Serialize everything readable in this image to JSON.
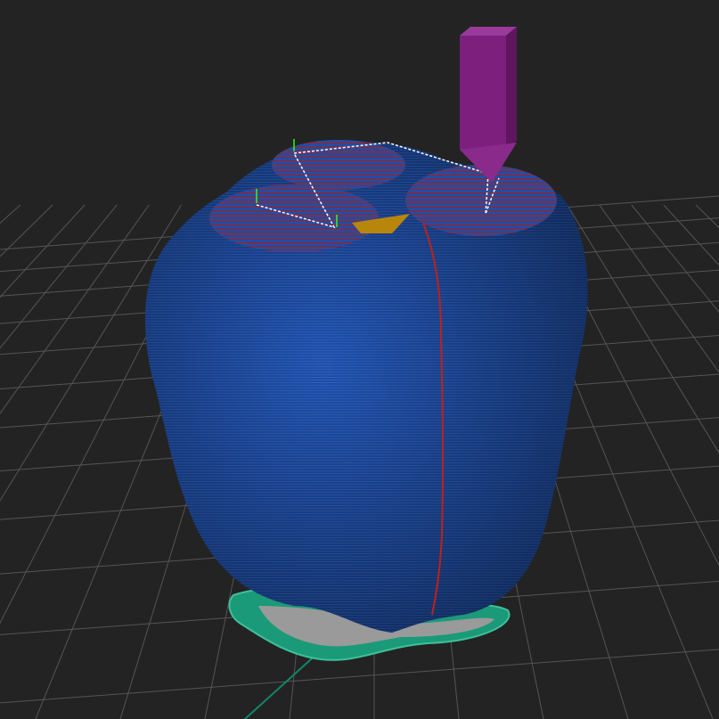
{
  "viewer": {
    "mode": "gcode-preview",
    "colors": {
      "background": "#232323",
      "grid": "#5a5a5a",
      "perimeter": "#1f4ea8",
      "perimeter_highlight": "#2f66c8",
      "seam": "#c0201a",
      "infill": "#b8860b",
      "skirt": "#1a9a78",
      "travel": "#ffffff",
      "tool": "#7d1f7d",
      "axis_x": "#12866a"
    }
  }
}
